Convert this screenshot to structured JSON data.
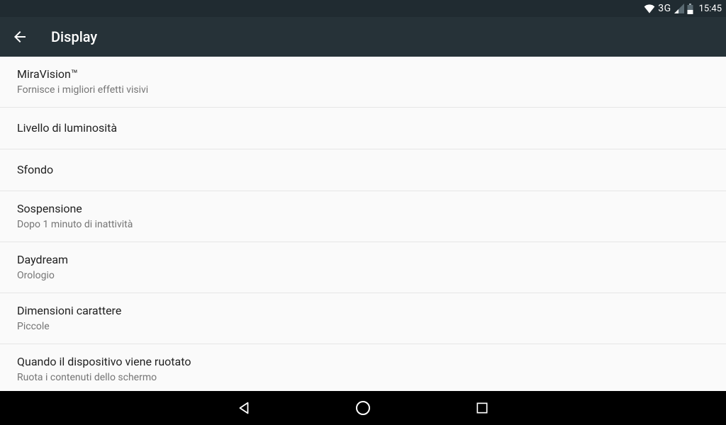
{
  "statusbar": {
    "network": "3G",
    "time": "15:45"
  },
  "appbar": {
    "title": "Display"
  },
  "items": [
    {
      "title": "MiraVision™",
      "subtitle": "Fornisce i migliori effetti visivi"
    },
    {
      "title": "Livello di luminosità",
      "subtitle": null
    },
    {
      "title": "Sfondo",
      "subtitle": null
    },
    {
      "title": "Sospensione",
      "subtitle": "Dopo 1 minuto di inattività"
    },
    {
      "title": "Daydream",
      "subtitle": "Orologio"
    },
    {
      "title": "Dimensioni carattere",
      "subtitle": "Piccole"
    },
    {
      "title": "Quando il dispositivo viene ruotato",
      "subtitle": "Ruota i contenuti dello schermo"
    }
  ]
}
